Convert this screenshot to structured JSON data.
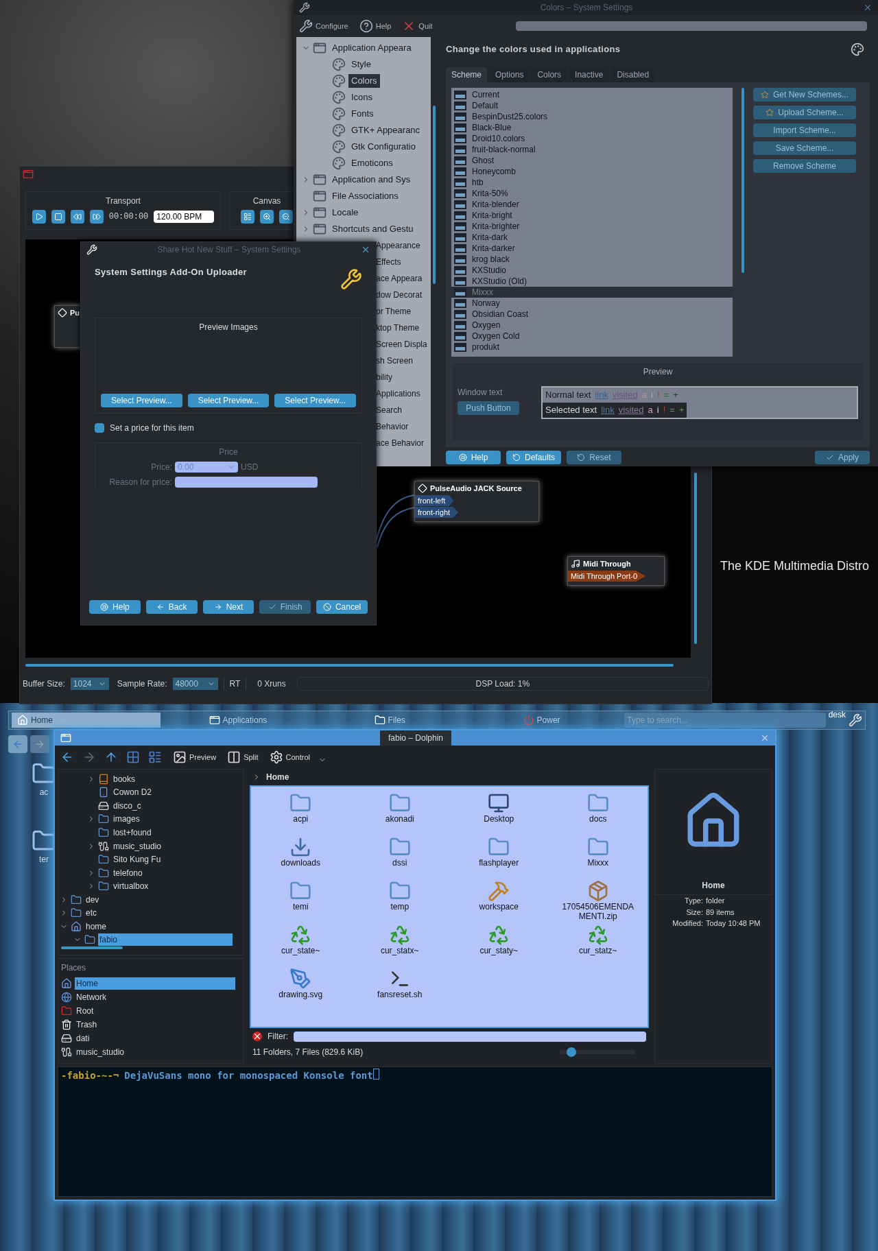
{
  "colors_window": {
    "title": "Colors – System Settings",
    "toolbar": [
      {
        "label": "Configure",
        "kind": "configure"
      },
      {
        "label": "Help",
        "kind": "help"
      },
      {
        "label": "Quit",
        "kind": "quit"
      }
    ],
    "tree": [
      {
        "label": "Application Appeara",
        "expanded": true,
        "selected": false,
        "children": [
          {
            "label": "Style",
            "selected": false
          },
          {
            "label": "Colors",
            "selected": true
          },
          {
            "label": "Icons",
            "selected": false
          },
          {
            "label": "Fonts",
            "selected": false
          },
          {
            "label": "GTK+ Appearanc",
            "selected": false
          },
          {
            "label": "Gtk Configuratio",
            "selected": false
          },
          {
            "label": "Emoticons",
            "selected": false
          }
        ]
      },
      {
        "label": "Application and Sys",
        "expanded": false,
        "selected": false
      },
      {
        "label": "File Associations",
        "selected": false
      },
      {
        "label": "Locale",
        "expanded": false,
        "selected": false
      },
      {
        "label": "Shortcuts and Gestu",
        "expanded": false,
        "selected": false
      }
    ],
    "covered_items": [
      "Appearance",
      "Effects",
      "ace Appeara",
      "dow Decorat",
      "or Theme",
      "ktop Theme",
      "Screen Displa",
      "sh Screen",
      "bility",
      "Applications",
      "Search",
      "Behavior",
      "ace Behavior"
    ],
    "heading": "Change the colors used in applications",
    "tabs": [
      {
        "label": "Scheme",
        "selected": true
      },
      {
        "label": "Options",
        "selected": false
      },
      {
        "label": "Colors",
        "selected": false
      },
      {
        "label": "Inactive",
        "selected": false
      },
      {
        "label": "Disabled",
        "selected": false
      }
    ],
    "schemes": [
      {
        "label": "Current",
        "selected": false
      },
      {
        "label": "Default",
        "selected": false
      },
      {
        "label": "BespinDust25.colors",
        "selected": false
      },
      {
        "label": "Black-Blue",
        "selected": false
      },
      {
        "label": "Droid10.colors",
        "selected": false
      },
      {
        "label": "fruit-black-normal",
        "selected": false
      },
      {
        "label": "Ghost",
        "selected": false
      },
      {
        "label": "Honeycomb",
        "selected": false
      },
      {
        "label": "htb",
        "selected": false
      },
      {
        "label": "Krita-50%",
        "selected": false
      },
      {
        "label": "Krita-blender",
        "selected": false
      },
      {
        "label": "Krita-bright",
        "selected": false
      },
      {
        "label": "Krita-brighter",
        "selected": false
      },
      {
        "label": "Krita-dark",
        "selected": false
      },
      {
        "label": "Krita-darker",
        "selected": false
      },
      {
        "label": "krog black",
        "selected": false
      },
      {
        "label": "KXStudio",
        "selected": false
      },
      {
        "label": "KXStudio (Old)",
        "selected": false
      },
      {
        "label": "Mixxx",
        "selected": true
      },
      {
        "label": "Norway",
        "selected": false
      },
      {
        "label": "Obsidian Coast",
        "selected": false
      },
      {
        "label": "Oxygen",
        "selected": false
      },
      {
        "label": "Oxygen Cold",
        "selected": false
      },
      {
        "label": "produkt",
        "selected": false
      }
    ],
    "side_buttons": [
      {
        "label": "Get New Schemes...",
        "kind": "star"
      },
      {
        "label": "Upload Scheme...",
        "kind": "star"
      },
      {
        "label": "Import Scheme...",
        "kind": "plain"
      },
      {
        "label": "Save Scheme...",
        "kind": "plain"
      },
      {
        "label": "Remove Scheme",
        "kind": "plain"
      }
    ],
    "preview": {
      "title": "Preview",
      "window_text": "Window text",
      "push_button": "Push Button",
      "normal": [
        {
          "text": "Normal text",
          "kind": "text"
        },
        {
          "text": "link",
          "kind": "link"
        },
        {
          "text": "visited",
          "kind": "visited"
        },
        {
          "text": "a",
          "kind": "active"
        },
        {
          "text": "i",
          "kind": "inactive"
        },
        {
          "text": "!",
          "kind": "negative"
        },
        {
          "text": "=",
          "kind": "neutral"
        },
        {
          "text": "+",
          "kind": "positive"
        }
      ],
      "selected": [
        {
          "text": "Selected text",
          "kind": "text"
        },
        {
          "text": "link",
          "kind": "link"
        },
        {
          "text": "visited",
          "kind": "visited"
        },
        {
          "text": "a",
          "kind": "active"
        },
        {
          "text": "i",
          "kind": "inactive"
        },
        {
          "text": "!",
          "kind": "negative"
        },
        {
          "text": "=",
          "kind": "neutral"
        },
        {
          "text": "+",
          "kind": "positive"
        }
      ]
    },
    "bottom_buttons": [
      {
        "label": "Help",
        "kind": "help",
        "disabled": false
      },
      {
        "label": "Defaults",
        "kind": "defaults",
        "disabled": false
      },
      {
        "label": "Reset",
        "kind": "reset",
        "disabled": true
      },
      {
        "label": "Apply",
        "kind": "apply",
        "disabled": true
      }
    ]
  },
  "cadence": {
    "transport": {
      "title": "Transport",
      "time": "00:00:00",
      "bpm": "120.00 BPM"
    },
    "canvas_panel": {
      "title": "Canvas"
    },
    "nodes": [
      {
        "title": "Pu"
      },
      {
        "title": "PulseAudio JACK Source",
        "ports": [
          {
            "label": "front-left",
            "kind": "audio"
          },
          {
            "label": "front-right",
            "kind": "audio"
          }
        ]
      },
      {
        "title": "Midi Through",
        "ports": [
          {
            "label": "Midi Through Port-0",
            "kind": "midi"
          }
        ]
      }
    ],
    "status": {
      "buffer_label": "Buffer Size:",
      "buffer": "1024",
      "rate_label": "Sample Rate:",
      "rate": "48000",
      "rt": "RT",
      "xruns": "0 Xruns",
      "dsp": "DSP Load: 1%"
    }
  },
  "dialog": {
    "title": "Share Hot New Stuff – System Settings",
    "heading": "System Settings Add-On Uploader",
    "preview_title": "Preview Images",
    "preview_buttons": [
      "Select Preview...",
      "Select Preview...",
      "Select Preview..."
    ],
    "price_checkbox": {
      "label": "Set a price for this item",
      "checked": false
    },
    "price": {
      "title": "Price",
      "price_label": "Price:",
      "price": "0.00",
      "currency": "USD",
      "reason_label": "Reason for price:"
    },
    "buttons": [
      {
        "label": "Help",
        "kind": "help",
        "disabled": false
      },
      {
        "label": "Back",
        "kind": "back",
        "disabled": false
      },
      {
        "label": "Next",
        "kind": "next",
        "disabled": false
      },
      {
        "label": "Finish",
        "kind": "finish",
        "disabled": true
      },
      {
        "label": "Cancel",
        "kind": "cancel",
        "disabled": false
      }
    ]
  },
  "desktop": {
    "tagline": "The KDE Multimedia Distro",
    "icons": [
      "ac",
      "ter"
    ]
  },
  "panel": {
    "tabs": [
      {
        "label": "Home",
        "kind": "home",
        "selected": true
      },
      {
        "label": "Applications",
        "kind": "apps",
        "selected": false
      },
      {
        "label": "Files",
        "kind": "files",
        "selected": false
      },
      {
        "label": "Power",
        "kind": "power",
        "selected": false
      }
    ],
    "search_placeholder": "Type to search...",
    "activity": "desk"
  },
  "dolphin": {
    "title": "fabio – Dolphin",
    "toolbar": [
      {
        "label": "Preview",
        "kind": "preview"
      },
      {
        "label": "Split",
        "kind": "split"
      },
      {
        "label": "Control",
        "kind": "control"
      }
    ],
    "tree": [
      {
        "children": [
          {
            "label": "books",
            "kind": "book",
            "expanded": false,
            "selected": false
          },
          {
            "label": "Cowon D2",
            "kind": "device",
            "selected": false
          },
          {
            "label": "disco_c",
            "kind": "drive",
            "selected": false
          },
          {
            "label": "images",
            "kind": "folder",
            "expanded": false,
            "selected": false
          },
          {
            "label": "lost+found",
            "kind": "folder",
            "selected": false
          },
          {
            "label": "music_studio",
            "kind": "cable",
            "expanded": false,
            "selected": false
          },
          {
            "label": "Sito Kung Fu",
            "kind": "folder",
            "selected": false
          },
          {
            "label": "telefono",
            "kind": "folder",
            "expanded": false,
            "selected": false
          },
          {
            "label": "virtualbox",
            "kind": "folder",
            "expanded": false,
            "selected": false
          }
        ]
      },
      {
        "label": "dev",
        "kind": "folder",
        "expanded": false,
        "selected": false
      },
      {
        "label": "etc",
        "kind": "folder",
        "expanded": false,
        "selected": false
      },
      {
        "label": "home",
        "kind": "home",
        "expanded": true,
        "selected": false,
        "children": [
          {
            "label": "fabio",
            "kind": "folder",
            "expanded": true,
            "selected": true
          }
        ]
      }
    ],
    "places_title": "Places",
    "places": [
      {
        "label": "Home",
        "kind": "home",
        "selected": true
      },
      {
        "label": "Network",
        "kind": "network",
        "selected": false
      },
      {
        "label": "Root",
        "kind": "root",
        "selected": false
      },
      {
        "label": "Trash",
        "kind": "trash",
        "selected": false
      },
      {
        "label": "dati",
        "kind": "drive",
        "selected": false
      },
      {
        "label": "music_studio",
        "kind": "cable",
        "selected": false
      }
    ],
    "breadcrumb": "Home",
    "files": [
      {
        "label": "acpi",
        "kind": "folder"
      },
      {
        "label": "akonadi",
        "kind": "folder"
      },
      {
        "label": "Desktop",
        "kind": "desktop"
      },
      {
        "label": "docs",
        "kind": "folder"
      },
      {
        "label": "downloads",
        "kind": "download"
      },
      {
        "label": "dssi",
        "kind": "folder"
      },
      {
        "label": "flashplayer",
        "kind": "folder"
      },
      {
        "label": "Mixxx",
        "kind": "folder"
      },
      {
        "label": "temi",
        "kind": "folder"
      },
      {
        "label": "temp",
        "kind": "folder"
      },
      {
        "label": "workspace",
        "kind": "tools"
      },
      {
        "label": "17054506EMENDAMENTI.zip",
        "kind": "zip"
      },
      {
        "label": "cur_state~",
        "kind": "backup"
      },
      {
        "label": "cur_statx~",
        "kind": "backup"
      },
      {
        "label": "cur_staty~",
        "kind": "backup"
      },
      {
        "label": "cur_statz~",
        "kind": "backup"
      },
      {
        "label": "drawing.svg",
        "kind": "svg"
      },
      {
        "label": "fansreset.sh",
        "kind": "script"
      }
    ],
    "info": {
      "title": "Home",
      "rows": [
        {
          "label": "Type:",
          "value": "folder"
        },
        {
          "label": "Size:",
          "value": "89 items"
        },
        {
          "label": "Modified:",
          "value": "Today 10:48 PM"
        }
      ]
    },
    "filter_label": "Filter:",
    "status": "11 Folders, 7 Files (829.6 KiB)",
    "zoom": {
      "level": 0.15
    }
  },
  "konsole": {
    "prompt": "-fabio-~-¬",
    "command": "DejaVuSans mono for monospaced Konsole font"
  }
}
